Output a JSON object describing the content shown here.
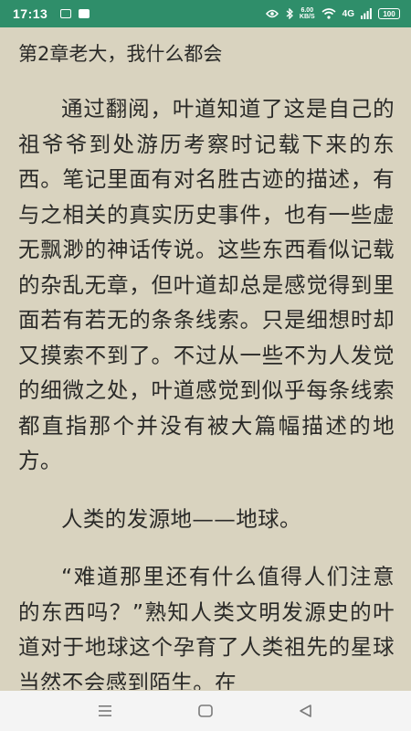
{
  "status_bar": {
    "time": "17:13",
    "net_speed_value": "6.00",
    "net_speed_unit": "KB/S",
    "signal_label": "4G",
    "battery": "100"
  },
  "reader": {
    "chapter_title": "第2章老大，我什么都会",
    "paragraphs": [
      "通过翻阅，叶道知道了这是自己的祖爷爷到处游历考察时记载下来的东西。笔记里面有对名胜古迹的描述，有与之相关的真实历史事件，也有一些虚无飘渺的神话传说。这些东西看似记载的杂乱无章，但叶道却总是感觉得到里面若有若无的条条线索。只是细想时却又摸索不到了。不过从一些不为人发觉的细微之处，叶道感觉到似乎每条线索都直指那个并没有被大篇幅描述的地方。",
      "人类的发源地——地球。",
      "“难道那里还有什么值得人们注意的东西吗？”熟知人类文明发源史的叶道对于地球这个孕育了人类祖先的星球当然不会感到陌生。在"
    ]
  },
  "colors": {
    "status_bar_bg": "#2f8e6a",
    "page_bg": "#d9d3bf",
    "text": "#2a2a28",
    "nav_bg": "#f4f4f4"
  },
  "icons": {
    "status_left": [
      "sim-icon",
      "message-icon"
    ],
    "status_right": [
      "nfc-icon",
      "bluetooth-icon",
      "wifi-icon",
      "signal-icon",
      "battery-icon"
    ],
    "nav": [
      "menu-icon",
      "home-icon",
      "back-icon"
    ]
  }
}
